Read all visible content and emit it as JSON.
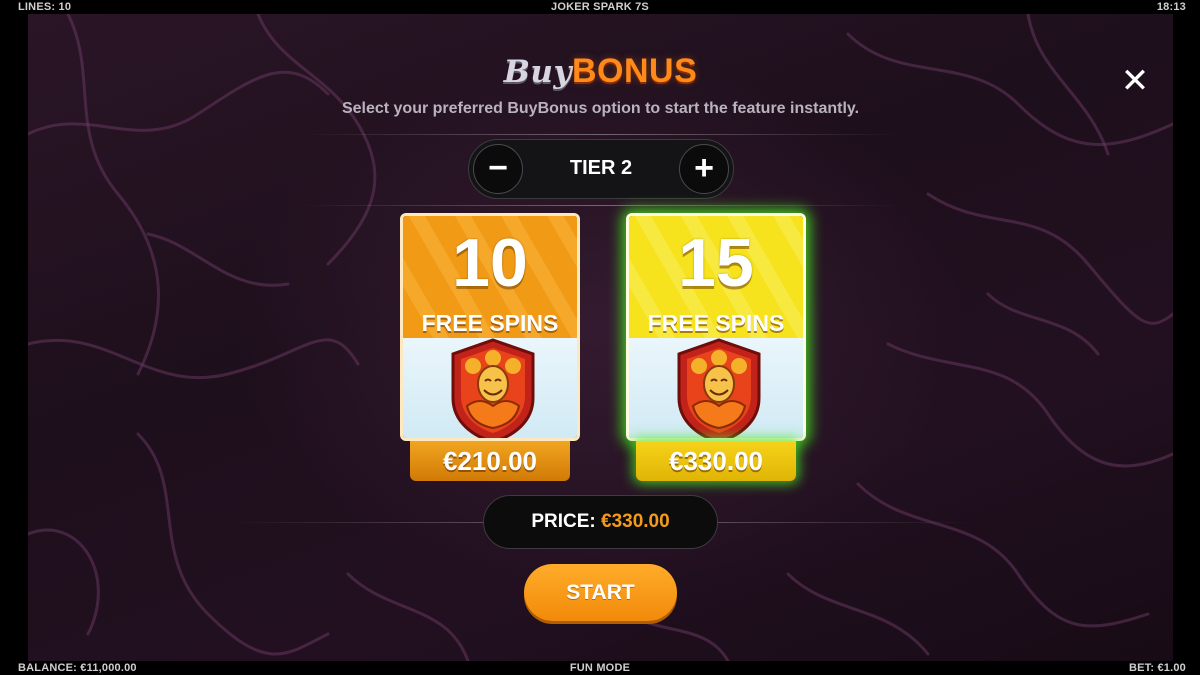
{
  "topbar": {
    "lines": "LINES: 10",
    "game_title": "JOKER SPARK 7S",
    "clock": "18:13"
  },
  "bottombar": {
    "balance": "BALANCE: €11,000.00",
    "mode": "FUN MODE",
    "bet": "BET: €1.00"
  },
  "header": {
    "title_buy": "Buy",
    "title_bonus": "BONUS",
    "subtitle": "Select your preferred BuyBonus option to start the feature instantly."
  },
  "close": {
    "label": "✕",
    "icon": "close-icon"
  },
  "tier_selector": {
    "minus_label": "−",
    "label": "TIER 2",
    "plus_label": "+"
  },
  "options": [
    {
      "spins": "10",
      "label": "FREE SPINS",
      "price": "€210.00",
      "color": "#f19a16",
      "selected": false,
      "icon": "joker-badge-icon"
    },
    {
      "spins": "15",
      "label": "FREE SPINS",
      "price": "€330.00",
      "color": "#f6e21d",
      "selected": true,
      "icon": "joker-badge-icon"
    }
  ],
  "price_display": {
    "label": "PRICE:",
    "value": "€330.00"
  },
  "start_button": {
    "label": "START"
  },
  "colors": {
    "accent": "#f49b1b",
    "selected_glow": "#46e61e",
    "background": "#1e0f1c"
  }
}
